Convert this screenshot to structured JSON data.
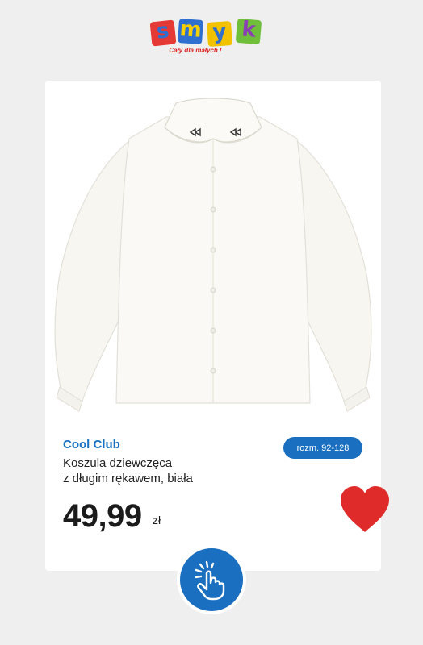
{
  "logo": {
    "letters": [
      "s",
      "m",
      "y",
      "k"
    ],
    "tile_colors": [
      "#e53935",
      "#2e6fd0",
      "#f2c200",
      "#6fbf3a"
    ],
    "letter_colors": [
      "#2e6fd0",
      "#f6d000",
      "#2e6fd0",
      "#8a3fb3"
    ],
    "tagline": "Cały dla małych !"
  },
  "product": {
    "brand": "Cool Club",
    "name_line1": "Koszula dziewczęca",
    "name_line2": "z długim rękawem, biała",
    "price": "49,99",
    "currency": "zł",
    "size": "rozm. 92-128",
    "image": "white-shirt-with-bow-collar"
  },
  "actions": {
    "favorite_icon": "heart-icon",
    "tap_icon": "hand-pointer-icon"
  },
  "colors": {
    "accent": "#1a6fc0",
    "heart": "#e02b2b",
    "background": "#efefef"
  }
}
